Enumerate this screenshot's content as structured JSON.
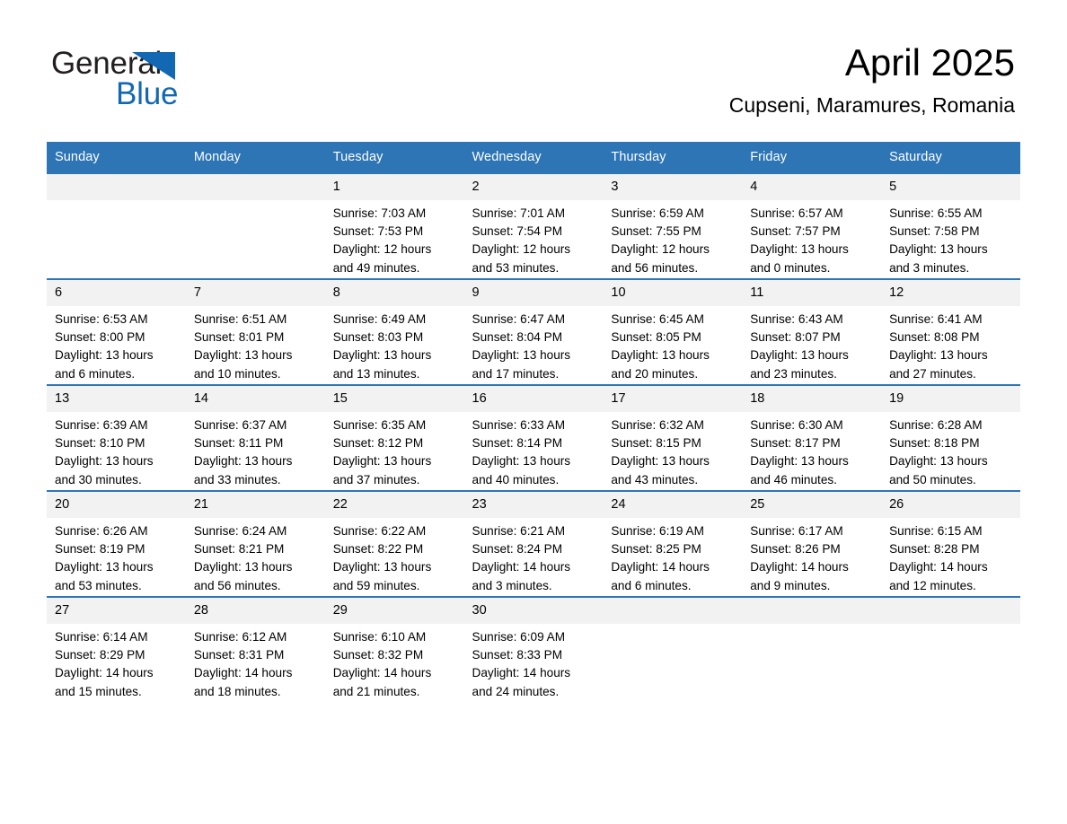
{
  "brand": {
    "name_part1": "General",
    "name_part2": "Blue",
    "triangle_color": "#1268b3",
    "text_color_dark": "#231f20"
  },
  "header": {
    "title": "April 2025",
    "subtitle": "Cupseni, Maramures, Romania"
  },
  "theme": {
    "header_bar_color": "#2e75b6",
    "row_divider_color": "#2e75b6",
    "daynum_band_color": "#f2f2f2",
    "page_background": "#ffffff"
  },
  "weekdays": [
    "Sunday",
    "Monday",
    "Tuesday",
    "Wednesday",
    "Thursday",
    "Friday",
    "Saturday"
  ],
  "weeks": [
    [
      {
        "day": "",
        "empty": true,
        "sunrise": "",
        "sunset": "",
        "daylight_line1": "",
        "daylight_line2": ""
      },
      {
        "day": "",
        "empty": true,
        "sunrise": "",
        "sunset": "",
        "daylight_line1": "",
        "daylight_line2": ""
      },
      {
        "day": "1",
        "empty": false,
        "sunrise": "Sunrise: 7:03 AM",
        "sunset": "Sunset: 7:53 PM",
        "daylight_line1": "Daylight: 12 hours",
        "daylight_line2": "and 49 minutes."
      },
      {
        "day": "2",
        "empty": false,
        "sunrise": "Sunrise: 7:01 AM",
        "sunset": "Sunset: 7:54 PM",
        "daylight_line1": "Daylight: 12 hours",
        "daylight_line2": "and 53 minutes."
      },
      {
        "day": "3",
        "empty": false,
        "sunrise": "Sunrise: 6:59 AM",
        "sunset": "Sunset: 7:55 PM",
        "daylight_line1": "Daylight: 12 hours",
        "daylight_line2": "and 56 minutes."
      },
      {
        "day": "4",
        "empty": false,
        "sunrise": "Sunrise: 6:57 AM",
        "sunset": "Sunset: 7:57 PM",
        "daylight_line1": "Daylight: 13 hours",
        "daylight_line2": "and 0 minutes."
      },
      {
        "day": "5",
        "empty": false,
        "sunrise": "Sunrise: 6:55 AM",
        "sunset": "Sunset: 7:58 PM",
        "daylight_line1": "Daylight: 13 hours",
        "daylight_line2": "and 3 minutes."
      }
    ],
    [
      {
        "day": "6",
        "empty": false,
        "sunrise": "Sunrise: 6:53 AM",
        "sunset": "Sunset: 8:00 PM",
        "daylight_line1": "Daylight: 13 hours",
        "daylight_line2": "and 6 minutes."
      },
      {
        "day": "7",
        "empty": false,
        "sunrise": "Sunrise: 6:51 AM",
        "sunset": "Sunset: 8:01 PM",
        "daylight_line1": "Daylight: 13 hours",
        "daylight_line2": "and 10 minutes."
      },
      {
        "day": "8",
        "empty": false,
        "sunrise": "Sunrise: 6:49 AM",
        "sunset": "Sunset: 8:03 PM",
        "daylight_line1": "Daylight: 13 hours",
        "daylight_line2": "and 13 minutes."
      },
      {
        "day": "9",
        "empty": false,
        "sunrise": "Sunrise: 6:47 AM",
        "sunset": "Sunset: 8:04 PM",
        "daylight_line1": "Daylight: 13 hours",
        "daylight_line2": "and 17 minutes."
      },
      {
        "day": "10",
        "empty": false,
        "sunrise": "Sunrise: 6:45 AM",
        "sunset": "Sunset: 8:05 PM",
        "daylight_line1": "Daylight: 13 hours",
        "daylight_line2": "and 20 minutes."
      },
      {
        "day": "11",
        "empty": false,
        "sunrise": "Sunrise: 6:43 AM",
        "sunset": "Sunset: 8:07 PM",
        "daylight_line1": "Daylight: 13 hours",
        "daylight_line2": "and 23 minutes."
      },
      {
        "day": "12",
        "empty": false,
        "sunrise": "Sunrise: 6:41 AM",
        "sunset": "Sunset: 8:08 PM",
        "daylight_line1": "Daylight: 13 hours",
        "daylight_line2": "and 27 minutes."
      }
    ],
    [
      {
        "day": "13",
        "empty": false,
        "sunrise": "Sunrise: 6:39 AM",
        "sunset": "Sunset: 8:10 PM",
        "daylight_line1": "Daylight: 13 hours",
        "daylight_line2": "and 30 minutes."
      },
      {
        "day": "14",
        "empty": false,
        "sunrise": "Sunrise: 6:37 AM",
        "sunset": "Sunset: 8:11 PM",
        "daylight_line1": "Daylight: 13 hours",
        "daylight_line2": "and 33 minutes."
      },
      {
        "day": "15",
        "empty": false,
        "sunrise": "Sunrise: 6:35 AM",
        "sunset": "Sunset: 8:12 PM",
        "daylight_line1": "Daylight: 13 hours",
        "daylight_line2": "and 37 minutes."
      },
      {
        "day": "16",
        "empty": false,
        "sunrise": "Sunrise: 6:33 AM",
        "sunset": "Sunset: 8:14 PM",
        "daylight_line1": "Daylight: 13 hours",
        "daylight_line2": "and 40 minutes."
      },
      {
        "day": "17",
        "empty": false,
        "sunrise": "Sunrise: 6:32 AM",
        "sunset": "Sunset: 8:15 PM",
        "daylight_line1": "Daylight: 13 hours",
        "daylight_line2": "and 43 minutes."
      },
      {
        "day": "18",
        "empty": false,
        "sunrise": "Sunrise: 6:30 AM",
        "sunset": "Sunset: 8:17 PM",
        "daylight_line1": "Daylight: 13 hours",
        "daylight_line2": "and 46 minutes."
      },
      {
        "day": "19",
        "empty": false,
        "sunrise": "Sunrise: 6:28 AM",
        "sunset": "Sunset: 8:18 PM",
        "daylight_line1": "Daylight: 13 hours",
        "daylight_line2": "and 50 minutes."
      }
    ],
    [
      {
        "day": "20",
        "empty": false,
        "sunrise": "Sunrise: 6:26 AM",
        "sunset": "Sunset: 8:19 PM",
        "daylight_line1": "Daylight: 13 hours",
        "daylight_line2": "and 53 minutes."
      },
      {
        "day": "21",
        "empty": false,
        "sunrise": "Sunrise: 6:24 AM",
        "sunset": "Sunset: 8:21 PM",
        "daylight_line1": "Daylight: 13 hours",
        "daylight_line2": "and 56 minutes."
      },
      {
        "day": "22",
        "empty": false,
        "sunrise": "Sunrise: 6:22 AM",
        "sunset": "Sunset: 8:22 PM",
        "daylight_line1": "Daylight: 13 hours",
        "daylight_line2": "and 59 minutes."
      },
      {
        "day": "23",
        "empty": false,
        "sunrise": "Sunrise: 6:21 AM",
        "sunset": "Sunset: 8:24 PM",
        "daylight_line1": "Daylight: 14 hours",
        "daylight_line2": "and 3 minutes."
      },
      {
        "day": "24",
        "empty": false,
        "sunrise": "Sunrise: 6:19 AM",
        "sunset": "Sunset: 8:25 PM",
        "daylight_line1": "Daylight: 14 hours",
        "daylight_line2": "and 6 minutes."
      },
      {
        "day": "25",
        "empty": false,
        "sunrise": "Sunrise: 6:17 AM",
        "sunset": "Sunset: 8:26 PM",
        "daylight_line1": "Daylight: 14 hours",
        "daylight_line2": "and 9 minutes."
      },
      {
        "day": "26",
        "empty": false,
        "sunrise": "Sunrise: 6:15 AM",
        "sunset": "Sunset: 8:28 PM",
        "daylight_line1": "Daylight: 14 hours",
        "daylight_line2": "and 12 minutes."
      }
    ],
    [
      {
        "day": "27",
        "empty": false,
        "sunrise": "Sunrise: 6:14 AM",
        "sunset": "Sunset: 8:29 PM",
        "daylight_line1": "Daylight: 14 hours",
        "daylight_line2": "and 15 minutes."
      },
      {
        "day": "28",
        "empty": false,
        "sunrise": "Sunrise: 6:12 AM",
        "sunset": "Sunset: 8:31 PM",
        "daylight_line1": "Daylight: 14 hours",
        "daylight_line2": "and 18 minutes."
      },
      {
        "day": "29",
        "empty": false,
        "sunrise": "Sunrise: 6:10 AM",
        "sunset": "Sunset: 8:32 PM",
        "daylight_line1": "Daylight: 14 hours",
        "daylight_line2": "and 21 minutes."
      },
      {
        "day": "30",
        "empty": false,
        "sunrise": "Sunrise: 6:09 AM",
        "sunset": "Sunset: 8:33 PM",
        "daylight_line1": "Daylight: 14 hours",
        "daylight_line2": "and 24 minutes."
      },
      {
        "day": "",
        "empty": true,
        "sunrise": "",
        "sunset": "",
        "daylight_line1": "",
        "daylight_line2": ""
      },
      {
        "day": "",
        "empty": true,
        "sunrise": "",
        "sunset": "",
        "daylight_line1": "",
        "daylight_line2": ""
      },
      {
        "day": "",
        "empty": true,
        "sunrise": "",
        "sunset": "",
        "daylight_line1": "",
        "daylight_line2": ""
      }
    ]
  ]
}
